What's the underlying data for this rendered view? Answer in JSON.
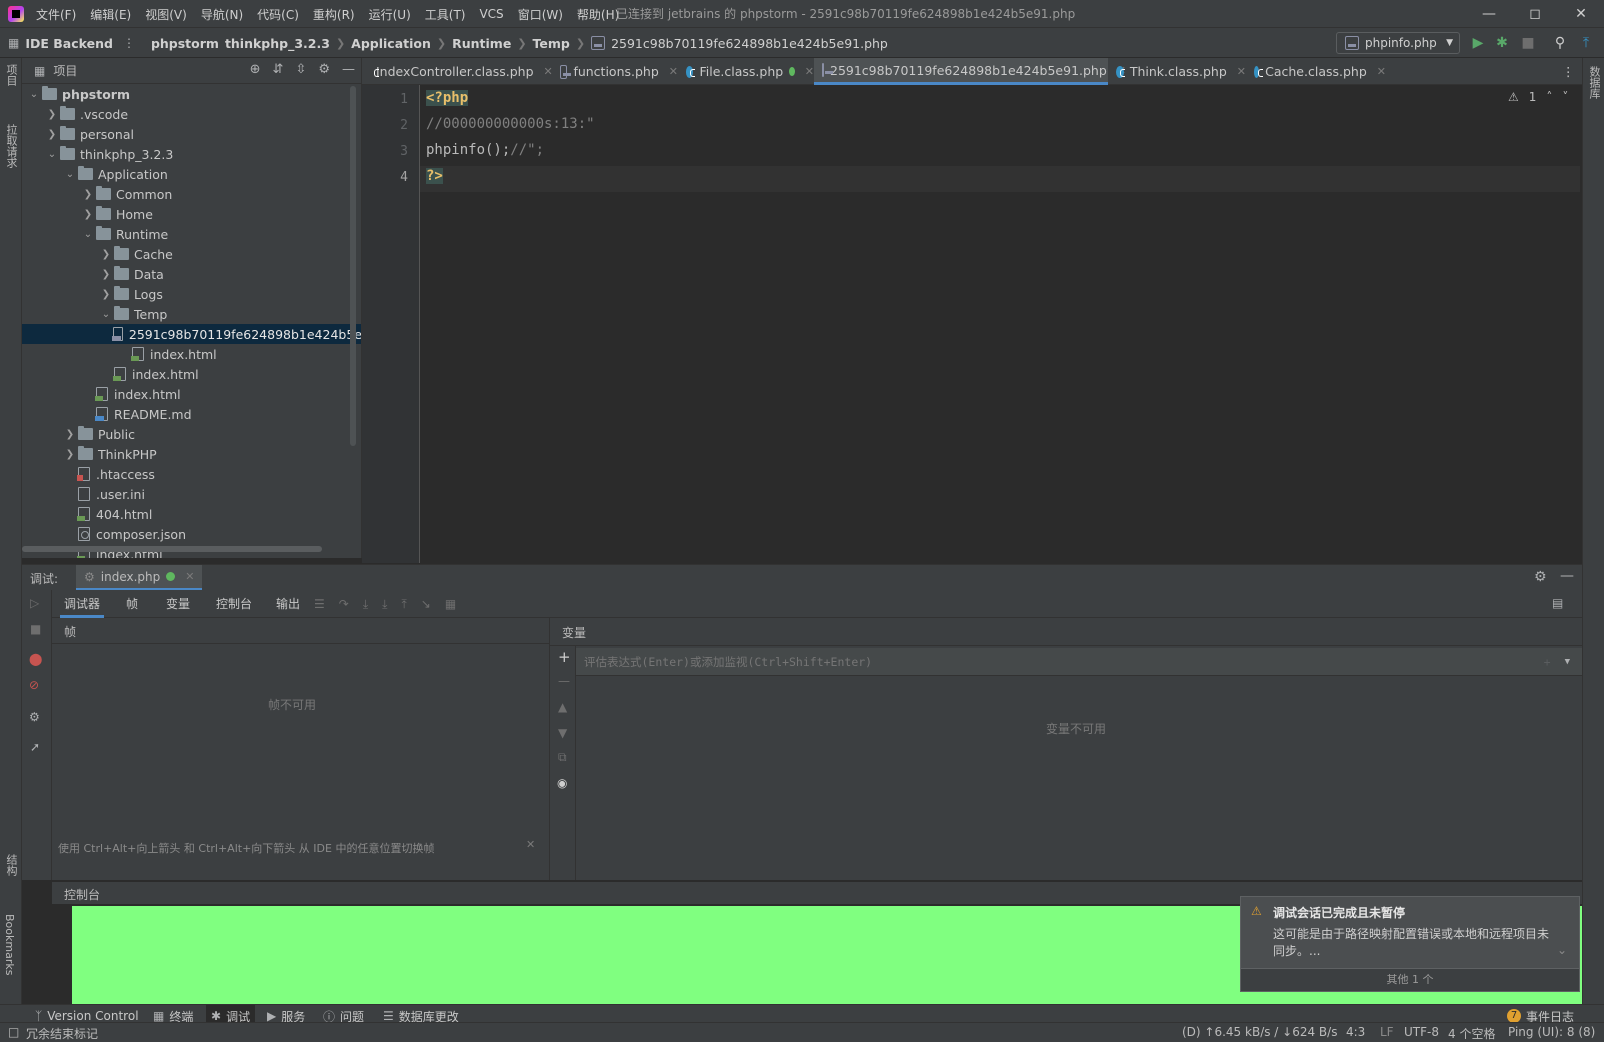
{
  "menubar": {
    "items": [
      "文件(F)",
      "编辑(E)",
      "视图(V)",
      "导航(N)",
      "代码(C)",
      "重构(R)",
      "运行(U)",
      "工具(T)",
      "VCS",
      "窗口(W)",
      "帮助(H)"
    ],
    "window_title": "已连接到 jetbrains 的 phpstorm - 2591c98b70119fe624898b1e424b5e91.php"
  },
  "navbar": {
    "backend": "IDE Backend",
    "crumbs": [
      "phpstorm",
      "thinkphp_3.2.3",
      "Application",
      "Runtime",
      "Temp"
    ],
    "current_file": "2591c98b70119fe624898b1e424b5e91.php",
    "run_config": "phpinfo.php"
  },
  "leftstrip": {
    "project": "项目",
    "pull": "拉取请求",
    "structure": "结构",
    "bookmarks": "Bookmarks"
  },
  "rightstrip": {
    "database": "数据库"
  },
  "project": {
    "title": "项目",
    "tree": [
      {
        "label": "phpstorm",
        "depth": 0,
        "type": "folder",
        "expanded": true,
        "bold": true
      },
      {
        "label": ".vscode",
        "depth": 1,
        "type": "folder",
        "expanded": false
      },
      {
        "label": "personal",
        "depth": 1,
        "type": "folder",
        "expanded": false
      },
      {
        "label": "thinkphp_3.2.3",
        "depth": 1,
        "type": "folder",
        "expanded": true
      },
      {
        "label": "Application",
        "depth": 2,
        "type": "folder",
        "expanded": true
      },
      {
        "label": "Common",
        "depth": 3,
        "type": "folder",
        "expanded": false
      },
      {
        "label": "Home",
        "depth": 3,
        "type": "folder",
        "expanded": false
      },
      {
        "label": "Runtime",
        "depth": 3,
        "type": "folder",
        "expanded": true
      },
      {
        "label": "Cache",
        "depth": 4,
        "type": "folder",
        "expanded": false
      },
      {
        "label": "Data",
        "depth": 4,
        "type": "folder",
        "expanded": false
      },
      {
        "label": "Logs",
        "depth": 4,
        "type": "folder",
        "expanded": false
      },
      {
        "label": "Temp",
        "depth": 4,
        "type": "folder",
        "expanded": true
      },
      {
        "label": "2591c98b70119fe624898b1e424b5e",
        "depth": 5,
        "type": "php",
        "selected": true
      },
      {
        "label": "index.html",
        "depth": 5,
        "type": "html"
      },
      {
        "label": "index.html",
        "depth": 4,
        "type": "html"
      },
      {
        "label": "index.html",
        "depth": 3,
        "type": "html"
      },
      {
        "label": "README.md",
        "depth": 3,
        "type": "md"
      },
      {
        "label": "Public",
        "depth": 2,
        "type": "folder",
        "expanded": false
      },
      {
        "label": "ThinkPHP",
        "depth": 2,
        "type": "folder",
        "expanded": false
      },
      {
        "label": ".htaccess",
        "depth": 2,
        "type": "ht"
      },
      {
        "label": ".user.ini",
        "depth": 2,
        "type": "ini"
      },
      {
        "label": "404.html",
        "depth": 2,
        "type": "html"
      },
      {
        "label": "composer.json",
        "depth": 2,
        "type": "json"
      },
      {
        "label": "index.html",
        "depth": 2,
        "type": "html"
      }
    ]
  },
  "editor": {
    "tabs": [
      {
        "label": "IndexController.class.php",
        "icon": "class-icon"
      },
      {
        "label": "functions.php",
        "icon": "php-file-icon"
      },
      {
        "label": "File.class.php",
        "icon": "class-icon"
      },
      {
        "label": "2591c98b70119fe624898b1e424b5e91.php",
        "icon": "php-file-icon",
        "active": true
      },
      {
        "label": "Think.class.php",
        "icon": "class-icon"
      },
      {
        "label": "Cache.class.php",
        "icon": "class-icon"
      }
    ],
    "line_numbers": [
      "1",
      "2",
      "3",
      "4"
    ],
    "code": {
      "line1": "<?php",
      "line2": "//000000000000s:13:\"",
      "line3_a": "phpinfo();",
      "line3_b": "//\";",
      "line4": "?>"
    },
    "warning_count": "1"
  },
  "debug": {
    "label": "调试:",
    "session": "index.php",
    "tabs": [
      "调试器",
      "帧",
      "变量",
      "控制台",
      "输出"
    ],
    "frames_header": "帧",
    "frames_empty": "帧不可用",
    "frames_hint": "使用 Ctrl+Alt+向上箭头 和 Ctrl+Alt+向下箭头 从 IDE 中的任意位置切换帧",
    "vars_header": "变量",
    "eval_placeholder": "评估表达式(Enter)或添加监视(Ctrl+Shift+Enter)",
    "vars_empty": "变量不可用",
    "console_label": "控制台",
    "console_color": "#80ff80"
  },
  "notification": {
    "title": "调试会话已完成且未暂停",
    "body": "这可能是由于路径映射配置错误或本地和远程项目未同步。...",
    "more": "其他 1 个"
  },
  "toolwindows": {
    "items": [
      "Version Control",
      "终端",
      "调试",
      "服务",
      "问题",
      "数据库更改"
    ],
    "active": "调试",
    "event_log": "事件日志",
    "event_count": "7"
  },
  "status": {
    "left": "冗余结束标记",
    "network": "(D) ↑6.45 kB/s / ↓624 B/s",
    "position": "4:3",
    "line_sep": "LF",
    "encoding": "UTF-8",
    "indent": "4 个空格",
    "ping": "Ping (UI): 8 (8)"
  }
}
